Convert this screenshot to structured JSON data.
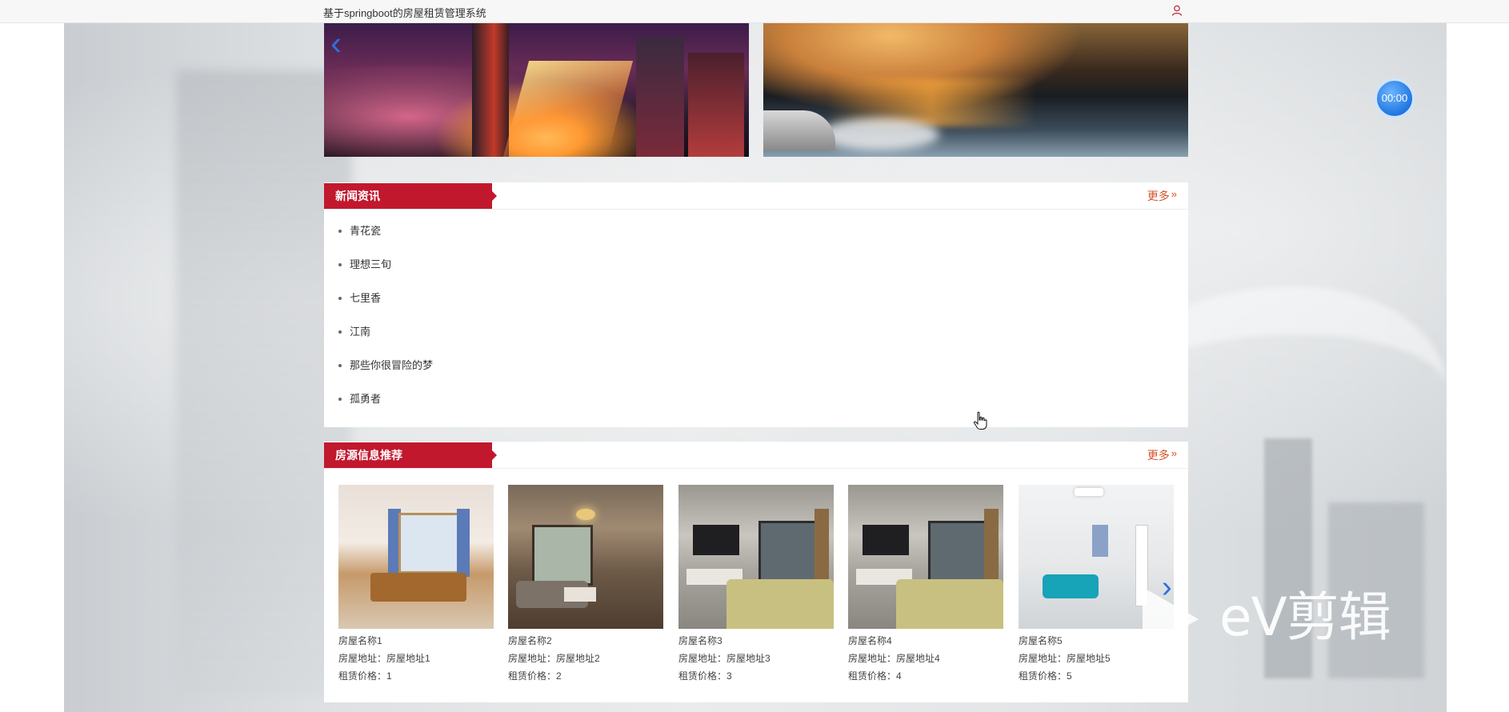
{
  "app": {
    "title": "基于springboot的房屋租赁管理系统"
  },
  "timer": {
    "label": "00:00"
  },
  "banner": {
    "prev_glyph": "‹"
  },
  "news": {
    "title": "新闻资讯",
    "more_label": "更多",
    "more_glyph": "»",
    "items": [
      {
        "label": "青花瓷"
      },
      {
        "label": "理想三旬"
      },
      {
        "label": "七里香"
      },
      {
        "label": "江南"
      },
      {
        "label": "那些你很冒险的梦"
      },
      {
        "label": "孤勇者"
      }
    ]
  },
  "houses": {
    "title": "房源信息推荐",
    "more_label": "更多",
    "more_glyph": "»",
    "next_glyph": "›",
    "items": [
      {
        "name": "房屋名称1",
        "address": "房屋地址：房屋地址1",
        "price": "租赁价格：1"
      },
      {
        "name": "房屋名称2",
        "address": "房屋地址：房屋地址2",
        "price": "租赁价格：2"
      },
      {
        "name": "房屋名称3",
        "address": "房屋地址：房屋地址3",
        "price": "租赁价格：3"
      },
      {
        "name": "房屋名称4",
        "address": "房屋地址：房屋地址4",
        "price": "租赁价格：4"
      },
      {
        "name": "房屋名称5",
        "address": "房屋地址：房屋地址5",
        "price": "租赁价格：5"
      }
    ]
  },
  "watermark": {
    "text": "eV剪辑"
  },
  "colors": {
    "accent_red": "#c1182e",
    "more_orange": "#d2532a",
    "arrow_blue": "#2f6fdb"
  }
}
